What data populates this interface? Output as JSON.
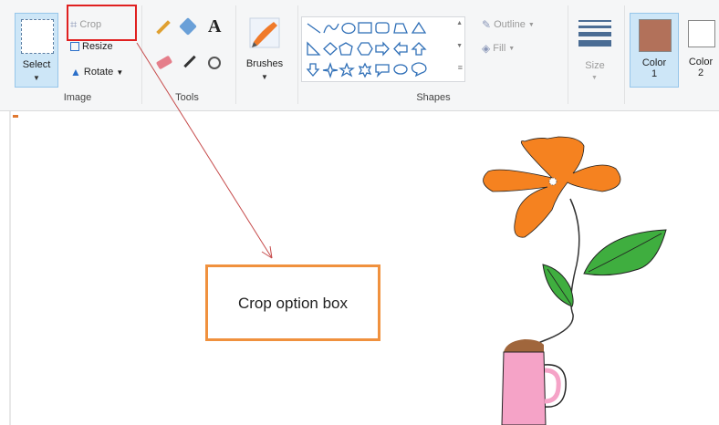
{
  "ribbon": {
    "image_group": {
      "label": "Image",
      "select_label": "Select",
      "crop_label": "Crop",
      "resize_label": "Resize",
      "rotate_label": "Rotate"
    },
    "tools_group": {
      "label": "Tools"
    },
    "brushes_group": {
      "label": "Brushes"
    },
    "shapes_group": {
      "label": "Shapes",
      "outline_label": "Outline",
      "fill_label": "Fill"
    },
    "size_group": {
      "label": "Size"
    },
    "color1": {
      "label_line1": "Color",
      "label_line2": "1",
      "swatch": "#b2715a"
    },
    "color2": {
      "label_line1": "Color",
      "label_line2": "2",
      "swatch": "#ffffff"
    }
  },
  "annotation": {
    "text": "Crop option box",
    "border_color": "#f0913e",
    "highlight_color": "#e02020"
  },
  "drawing": {
    "petal_color": "#f58220",
    "leaf_color": "#3fae3f",
    "cup_color": "#f5a3c7",
    "soil_color": "#a0663c"
  }
}
